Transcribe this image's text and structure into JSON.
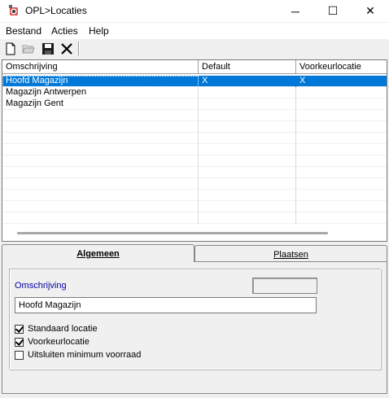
{
  "window": {
    "title": "OPL>Locaties",
    "min_glyph": "─",
    "max_glyph": "☐",
    "close_glyph": "✕"
  },
  "menu": {
    "items": [
      "Bestand",
      "Acties",
      "Help"
    ]
  },
  "toolbar": {
    "buttons": [
      {
        "icon": "new-document-icon"
      },
      {
        "icon": "open-folder-icon"
      },
      {
        "icon": "save-icon"
      },
      {
        "icon": "delete-icon"
      }
    ]
  },
  "grid": {
    "columns": [
      "Omschrijving",
      "Default",
      "Voorkeurlocatie"
    ],
    "rows": [
      {
        "omschrijving": "Hoofd Magazijn",
        "default": "X",
        "voorkeur": "X",
        "selected": true
      },
      {
        "omschrijving": "Magazijn Antwerpen",
        "default": "",
        "voorkeur": "",
        "selected": false
      },
      {
        "omschrijving": "Magazijn Gent",
        "default": "",
        "voorkeur": "",
        "selected": false
      }
    ],
    "selection_color": "#0078d7"
  },
  "tabs": {
    "algemeen": "Algemeen",
    "plaatsen": "Plaatsen",
    "active": "Algemeen"
  },
  "form": {
    "omschrijving_label": "Omschrijving",
    "omschrijving_value": "Hoofd Magazijn",
    "checkboxes": [
      {
        "label": "Standaard locatie",
        "checked": true
      },
      {
        "label": "Voorkeurlocatie",
        "checked": true
      },
      {
        "label": "Uitsluiten minimum voorraad",
        "checked": false
      }
    ]
  }
}
